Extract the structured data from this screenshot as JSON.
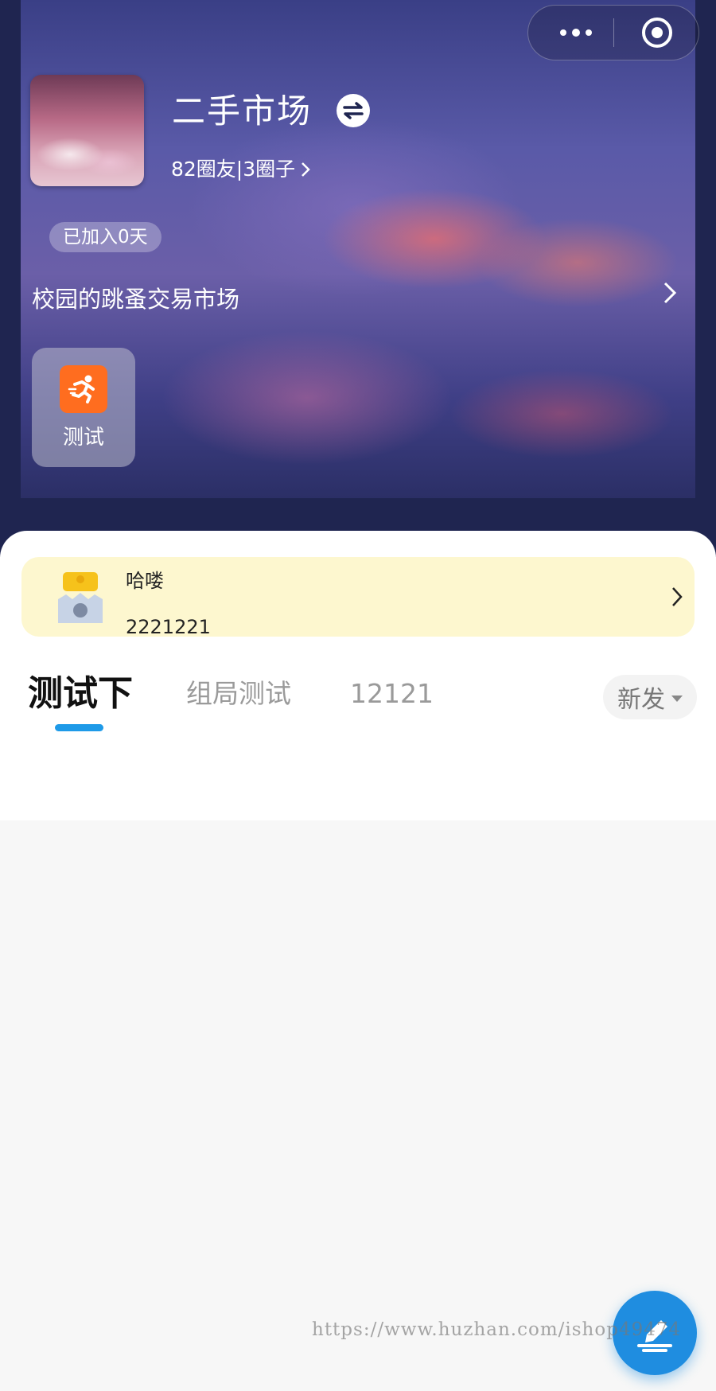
{
  "header": {
    "title": "二手市场",
    "stats": "82圈友|3圈子",
    "joined_badge": "已加入0天",
    "description": "校园的跳蚤交易市场",
    "app_tile": {
      "label": "测试",
      "icon": "running-person-icon"
    }
  },
  "capsule": {
    "more_icon": "more-dots-icon",
    "close_icon": "target-close-icon"
  },
  "notice": {
    "title": "哈喽",
    "subtitle": "2221221"
  },
  "tabs": [
    {
      "label": "测试下",
      "active": true
    },
    {
      "label": "组局测试",
      "active": false
    },
    {
      "label": "12121",
      "active": false
    }
  ],
  "sort": {
    "label": "新发"
  },
  "fab": {
    "icon": "edit-post-icon"
  },
  "watermark": "https://www.huzhan.com/ishop49474",
  "colors": {
    "accent": "#1e9ae8",
    "fab": "#1f8de0",
    "notice_bg": "#fdf7cf",
    "app_icon": "#ff6d1f",
    "header_bg": "#1f2550"
  }
}
